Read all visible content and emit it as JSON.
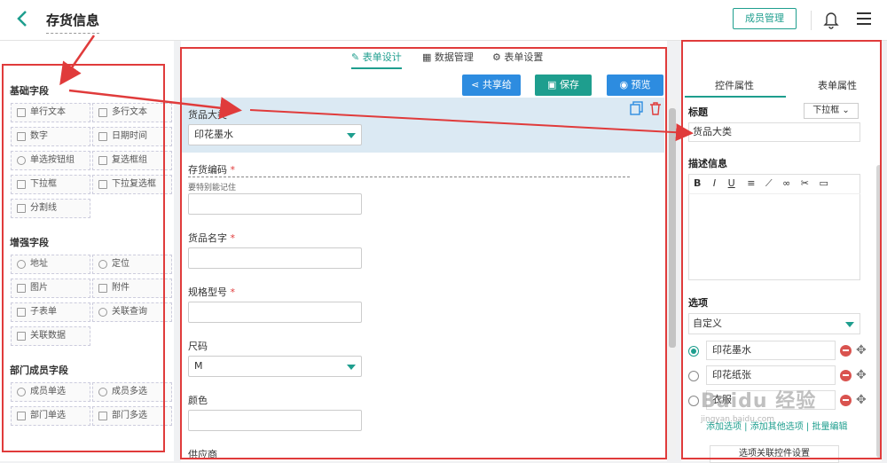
{
  "header": {
    "title": "存货信息",
    "member_button": "成员管理"
  },
  "left_panel": {
    "basic_title": "基础字段",
    "basic_fields": [
      "单行文本",
      "多行文本",
      "数字",
      "日期时间",
      "单选按钮组",
      "复选框组",
      "下拉框",
      "下拉复选框",
      "分割线"
    ],
    "enhanced_title": "增强字段",
    "enhanced_fields": [
      "地址",
      "定位",
      "图片",
      "附件",
      "子表单",
      "关联查询",
      "关联数据"
    ],
    "dept_title": "部门成员字段",
    "dept_fields": [
      "成员单选",
      "成员多选",
      "部门单选",
      "部门多选"
    ]
  },
  "center": {
    "tabs": [
      "表单设计",
      "数据管理",
      "表单设置"
    ],
    "share_button": "共享给",
    "save_button": "保存",
    "preview_button": "预览",
    "fields": [
      {
        "label": "货品大类",
        "value": "印花墨水"
      },
      {
        "label": "存货编码",
        "required": "*",
        "hint": "要特别能记住"
      },
      {
        "label": "货品名字",
        "required": "*"
      },
      {
        "label": "规格型号",
        "required": "*"
      },
      {
        "label": "尺码",
        "value": "M"
      },
      {
        "label": "颜色"
      },
      {
        "label": "供应商"
      }
    ]
  },
  "right_panel": {
    "tabs": [
      "控件属性",
      "表单属性"
    ],
    "title_label": "标题",
    "control_type": "下拉框",
    "title_value": "货品大类",
    "desc_label": "描述信息",
    "toolbar": [
      "B",
      "I",
      "U"
    ],
    "options_label": "选项",
    "options_mode": "自定义",
    "options": [
      "印花墨水",
      "印花纸张",
      "衣服"
    ],
    "add_option": "添加选项",
    "add_other": "添加其他选项",
    "batch_edit": "批量编辑",
    "link_settings": "选项关联控件设置"
  },
  "watermark": {
    "brand": "Baidu 经验",
    "url": "jingyan.baidu.com"
  },
  "colors": {
    "accent": "#1e9e8e",
    "blue": "#2d8ce0",
    "annotation": "#e03b3b"
  }
}
